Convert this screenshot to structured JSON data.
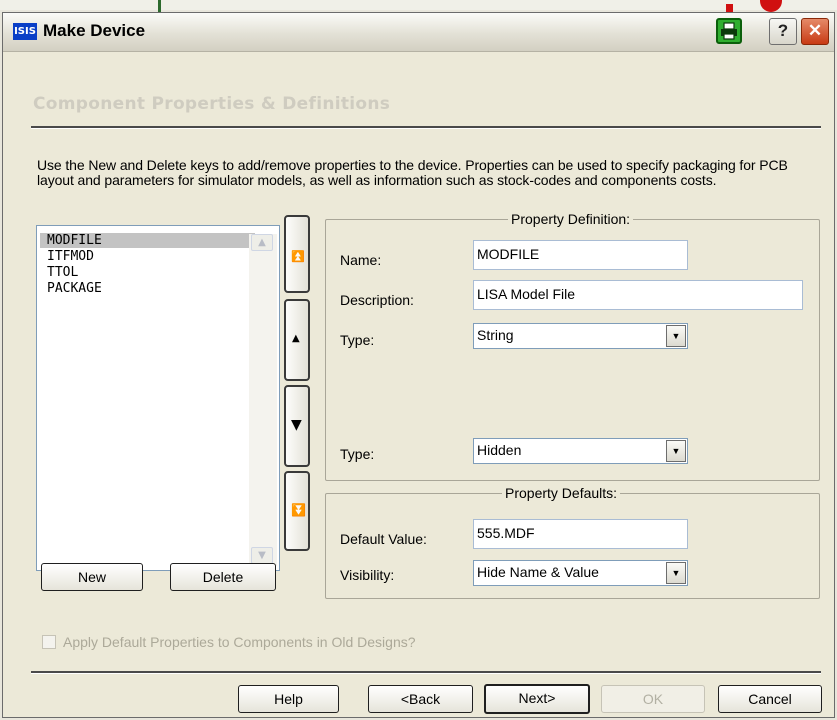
{
  "window": {
    "app_icon_text": "ISIS",
    "title": "Make Device",
    "help_glyph": "?",
    "close_glyph": "✕"
  },
  "section_header": "Component Properties & Definitions",
  "intro_text": "Use the New and Delete keys to add/remove properties to the device. Properties can be used to specify packaging for PCB layout and parameters for simulator models, as well as information such as stock-codes and components costs.",
  "property_list": {
    "items": [
      {
        "label": "MODFILE",
        "selected": true
      },
      {
        "label": "ITFMOD",
        "selected": false
      },
      {
        "label": "TTOL",
        "selected": false
      },
      {
        "label": "PACKAGE",
        "selected": false
      }
    ]
  },
  "move_buttons": {
    "top_glyph": "⏫",
    "up_glyph": "▲",
    "down_glyph": "▼",
    "bottom_glyph": "⏬"
  },
  "list_buttons": {
    "new_label": "New",
    "delete_label": "Delete"
  },
  "property_definition": {
    "group_title": "Property Definition:",
    "name_label": "Name:",
    "name_value": "MODFILE",
    "description_label": "Description:",
    "description_value": "LISA Model File",
    "type_label": "Type:",
    "type_value": "String",
    "type2_label": "Type:",
    "type2_value": "Hidden"
  },
  "property_defaults": {
    "group_title": "Property Defaults:",
    "default_value_label": "Default Value:",
    "default_value": "555.MDF",
    "visibility_label": "Visibility:",
    "visibility_value": "Hide Name & Value"
  },
  "apply_checkbox": {
    "label": "Apply Default Properties to Components in Old Designs?",
    "checked": false
  },
  "footer_buttons": {
    "help": "Help",
    "back": "<Back",
    "next": "Next>",
    "ok": "OK",
    "cancel": "Cancel"
  },
  "colors": {
    "dialog_bg": "#ece9d8",
    "selection_bg": "#c3c3c3",
    "disabled_text": "#aca999",
    "print_icon_green": "#2fae2f",
    "close_red": "#c83a14"
  }
}
